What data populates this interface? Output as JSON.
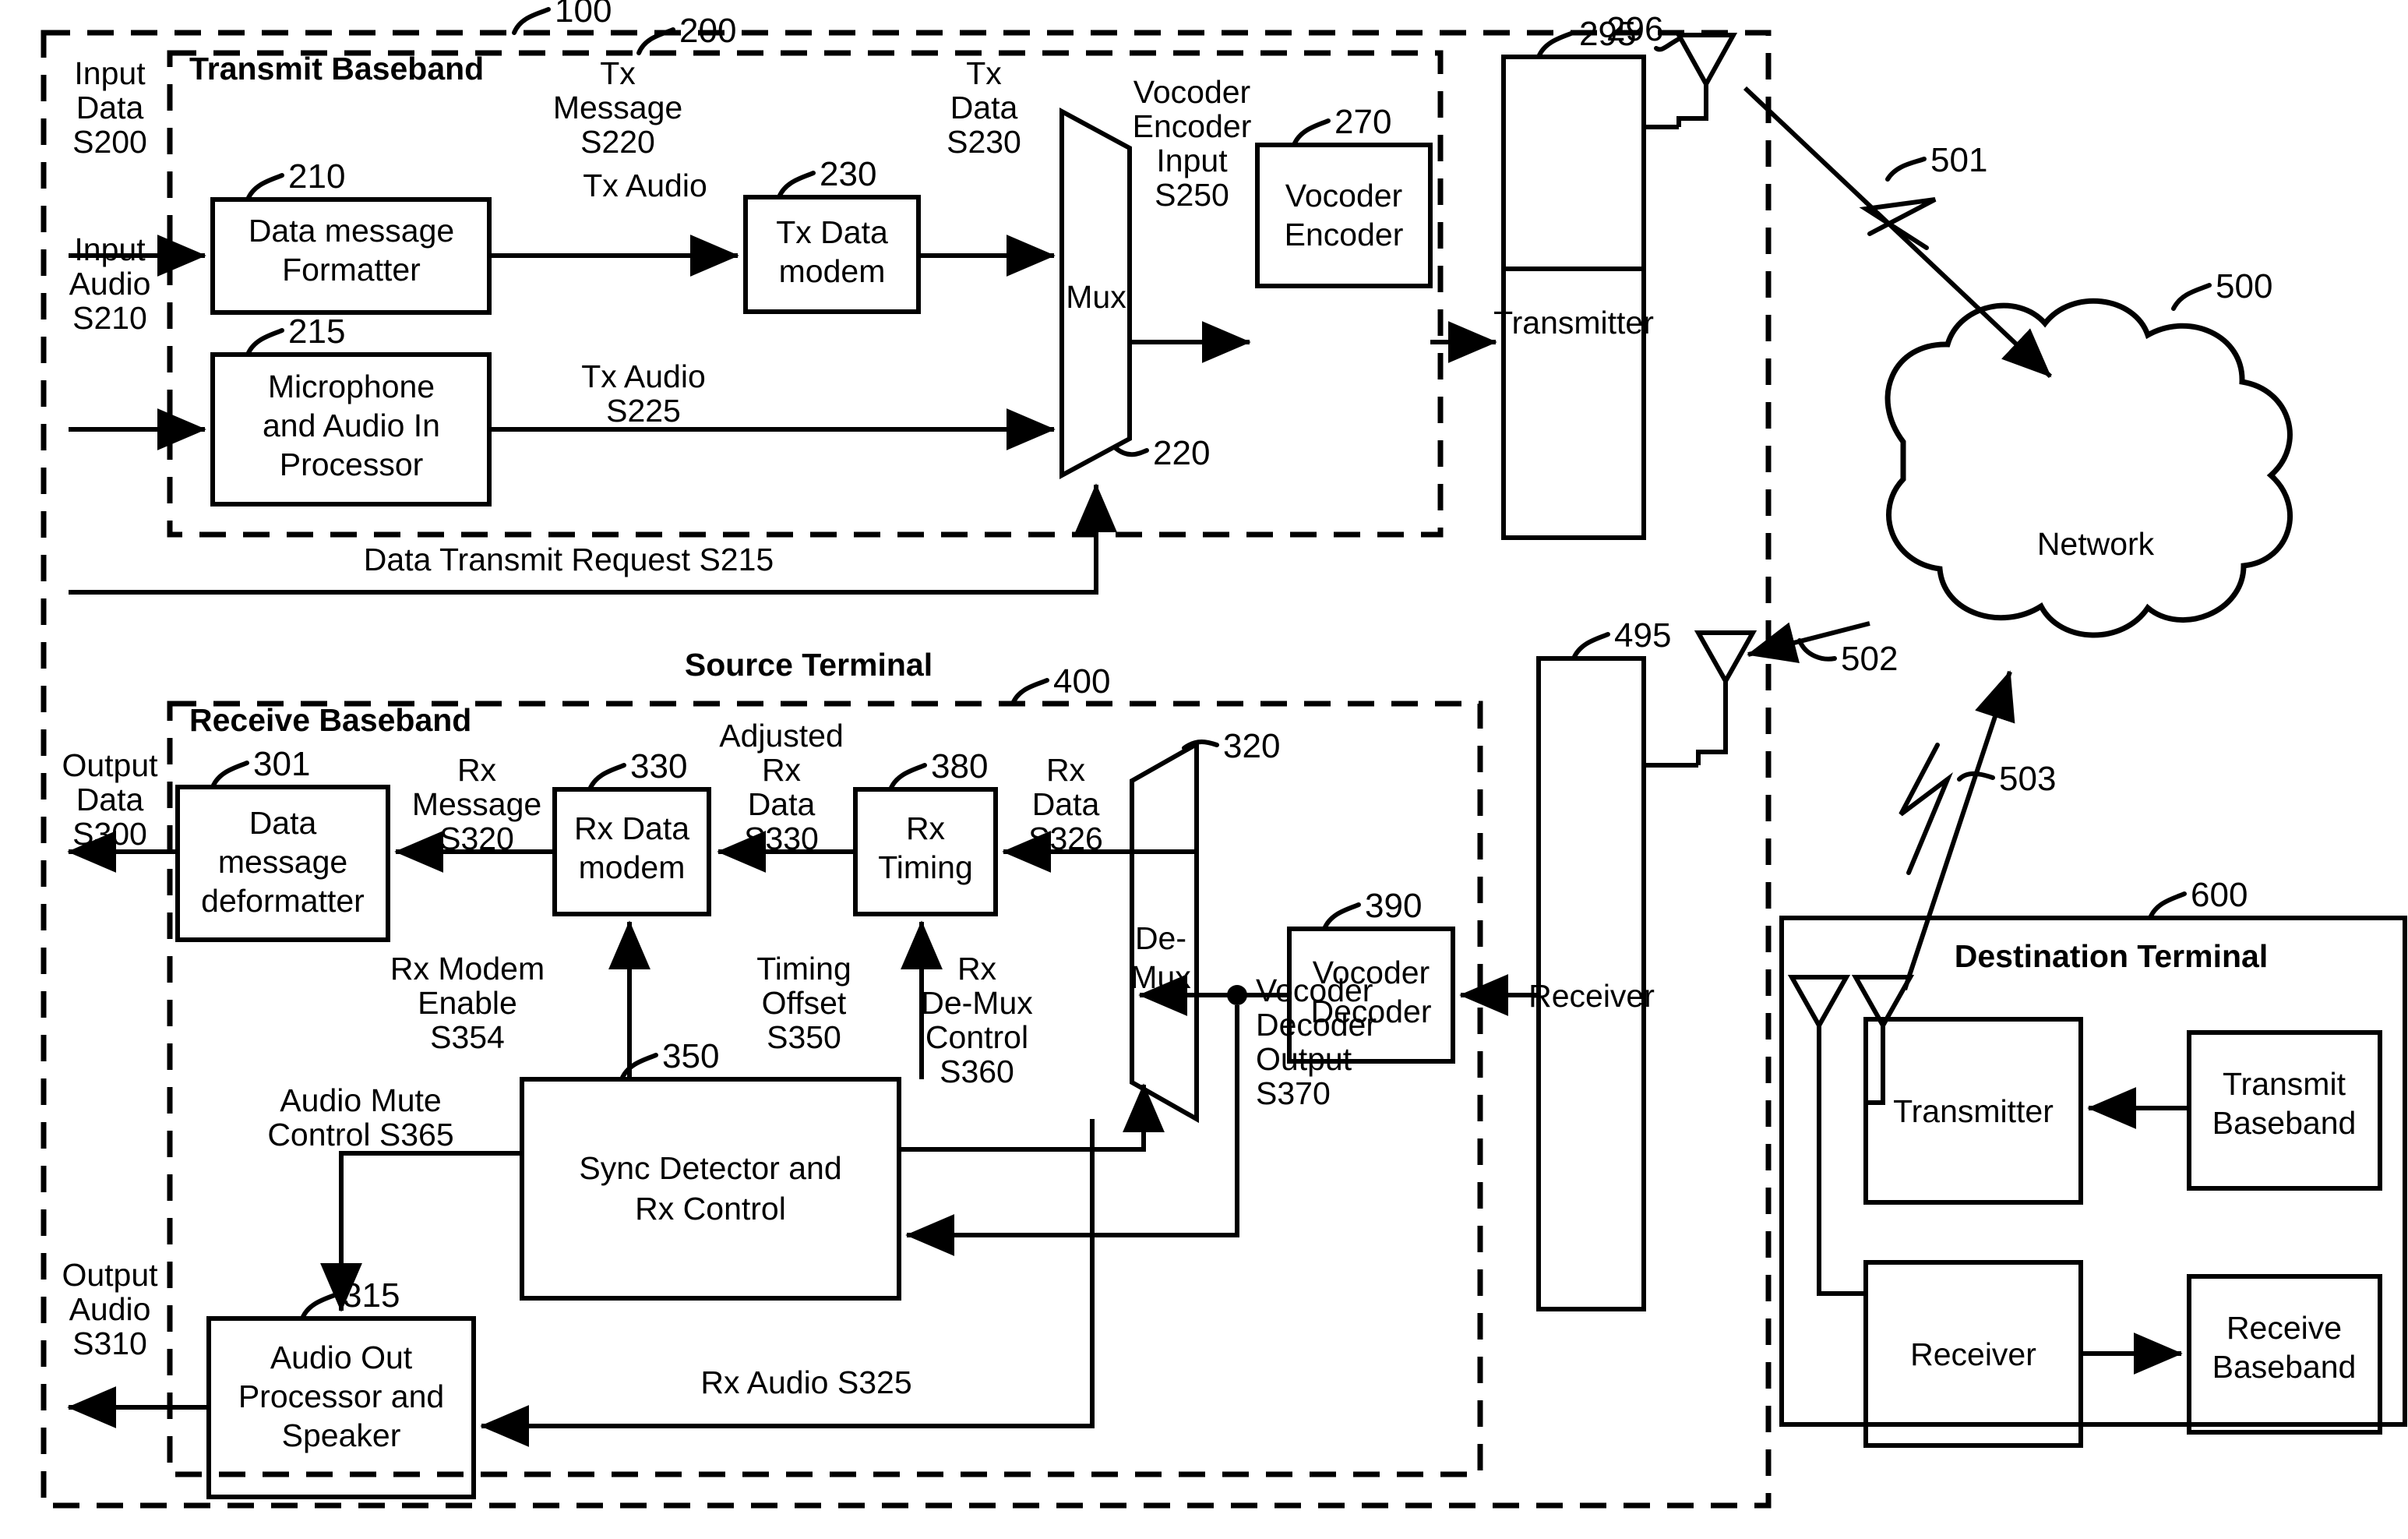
{
  "figure": {
    "title": "Source Terminal and Destination Terminal block diagram",
    "reference_numerals": {
      "outer_terminal": "100",
      "transmit_baseband": "200",
      "data_message_formatter": "210",
      "microphone_audio_in": "215",
      "mux": "220",
      "tx_data_modem": "230",
      "vocoder_encoder": "270",
      "transmitter": "295",
      "tx_antenna": "296",
      "data_message_deformatter": "301",
      "audio_out_processor": "315",
      "de_mux": "320",
      "rx_data_modem": "330",
      "sync_detector": "350",
      "rx_timing": "380",
      "vocoder_decoder": "390",
      "receive_baseband": "400",
      "receiver": "495",
      "network": "500",
      "link_up": "501",
      "link_down": "502",
      "link_dest": "503",
      "destination_terminal": "600"
    }
  },
  "labels": {
    "source_terminal": "Source Terminal",
    "transmit_baseband": "Transmit Baseband",
    "receive_baseband": "Receive Baseband",
    "destination_terminal": "Destination Terminal",
    "network": "Network"
  },
  "blocks": {
    "data_message_formatter": "Data message Formatter",
    "data_message_formatter_l1": "Data message",
    "data_message_formatter_l2": "Formatter",
    "microphone_l1": "Microphone",
    "microphone_l2": "and Audio In",
    "microphone_l3": "Processor",
    "tx_data_modem_l1": "Tx Data",
    "tx_data_modem_l2": "modem",
    "mux": "Mux",
    "vocoder_encoder_l1": "Vocoder",
    "vocoder_encoder_l2": "Encoder",
    "transmitter": "Transmitter",
    "receiver": "Receiver",
    "vocoder_decoder_l1": "Vocoder",
    "vocoder_decoder_l2": "Decoder",
    "demux_l1": "De-",
    "demux_l2": "Mux",
    "rx_timing_l1": "Rx",
    "rx_timing_l2": "Timing",
    "rx_data_modem_l1": "Rx Data",
    "rx_data_modem_l2": "modem",
    "data_message_deformatter_l1": "Data",
    "data_message_deformatter_l2": "message",
    "data_message_deformatter_l3": "deformatter",
    "sync_detector_l1": "Sync Detector and",
    "sync_detector_l2": "Rx Control",
    "audio_out_l1": "Audio Out",
    "audio_out_l2": "Processor and",
    "audio_out_l3": "Speaker",
    "dest_transmitter": "Transmitter",
    "dest_transmit_baseband_l1": "Transmit",
    "dest_transmit_baseband_l2": "Baseband",
    "dest_receiver": "Receiver",
    "dest_receive_baseband_l1": "Receive",
    "dest_receive_baseband_l2": "Baseband"
  },
  "signals": {
    "input_data_l1": "Input",
    "input_data_l2": "Data",
    "input_data_l3": "S200",
    "input_audio_l1": "Input",
    "input_audio_l2": "Audio",
    "input_audio_l3": "S210",
    "tx_message_l1": "Tx",
    "tx_message_l2": "Message",
    "tx_message_l3": "S220",
    "tx_data_l1": "Tx",
    "tx_data_l2": "Data",
    "tx_data_l3": "S230",
    "tx_audio_l1": "Tx Audio",
    "tx_audio_l2": "S225",
    "vocoder_encoder_input_l1": "Vocoder",
    "vocoder_encoder_input_l2": "Encoder",
    "vocoder_encoder_input_l3": "Input",
    "vocoder_encoder_input_l4": "S250",
    "data_transmit_request": "Data Transmit Request  S215",
    "output_data_l1": "Output",
    "output_data_l2": "Data",
    "output_data_l3": "S300",
    "output_audio_l1": "Output",
    "output_audio_l2": "Audio",
    "output_audio_l3": "S310",
    "rx_message_l1": "Rx",
    "rx_message_l2": "Message",
    "rx_message_l3": "S320",
    "adjusted_rx_data_l1": "Adjusted",
    "adjusted_rx_data_l2": "Rx",
    "adjusted_rx_data_l3": "Data",
    "adjusted_rx_data_l4": "S330",
    "rx_data_l1": "Rx",
    "rx_data_l2": "Data",
    "rx_data_l3": "S326",
    "rx_modem_enable_l1": "Rx Modem",
    "rx_modem_enable_l2": "Enable",
    "rx_modem_enable_l3": "S354",
    "timing_offset_l1": "Timing",
    "timing_offset_l2": "Offset",
    "timing_offset_l3": "S350",
    "rx_demux_control_l1": "Rx",
    "rx_demux_control_l2": "De-Mux",
    "rx_demux_control_l3": "Control",
    "rx_demux_control_l4": "S360",
    "vocoder_decoder_output_l1": "Vocoder",
    "vocoder_decoder_output_l2": "Decoder",
    "vocoder_decoder_output_l3": "Output",
    "vocoder_decoder_output_l4": "S370",
    "audio_mute_control_l1": "Audio Mute",
    "audio_mute_control_l2": "Control  S365",
    "rx_audio": "Rx Audio S325"
  }
}
